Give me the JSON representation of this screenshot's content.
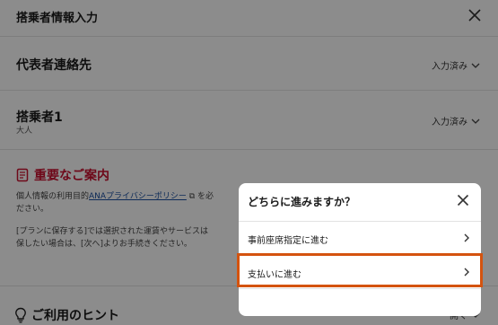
{
  "header": {
    "title": "搭乗者情報入力",
    "close_icon": "close-icon"
  },
  "representative": {
    "title": "代表者連絡先",
    "status": "入力済み"
  },
  "passenger": {
    "title": "搭乗者1",
    "subtitle": "大人",
    "status": "入力済み"
  },
  "notice": {
    "title": "重要なご案内",
    "icon": "document-icon",
    "line1_prefix": "個人情報の利用目的",
    "line1_link": "ANAプライバシーポリシー",
    "line1_suffix": "を必",
    "line2": "ださい。",
    "line3": "[プランに保存する]では選択された運賃やサービスは",
    "line4": "保したい場合は、[次へ]よりお手続きください。"
  },
  "hint": {
    "title": "ご利用のヒント",
    "icon": "lightbulb-icon",
    "toggle": "開く"
  },
  "dialog": {
    "title": "どちらに進みますか？",
    "close_icon": "close-icon",
    "options": [
      {
        "label": "事前座席指定に進む"
      },
      {
        "label": "支払いに進む"
      }
    ]
  },
  "colors": {
    "accent_red": "#c8102e",
    "highlight_orange": "#d4530f",
    "link_blue": "#1b4fa0"
  }
}
